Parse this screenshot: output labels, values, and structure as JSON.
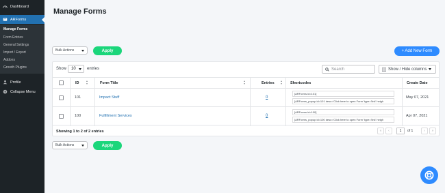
{
  "sidebar": {
    "dashboard": "Dashboard",
    "arforms": "ARForms",
    "submenu": [
      "Manage Forms",
      "Form Entries",
      "General Settings",
      "Import / Export",
      "Addons",
      "Growth Plugins"
    ],
    "profile": "Profile",
    "collapse": "Collapse Menu"
  },
  "page": {
    "title": "Manage Forms"
  },
  "top_actions": {
    "bulk_label": "Bulk Actions",
    "apply_label": "Apply",
    "add_new_label": "+ Add New Form"
  },
  "bottom_actions": {
    "bulk_label": "Bulk Actions",
    "apply_label": "Apply"
  },
  "table_controls": {
    "show_label": "Show",
    "show_value": "10",
    "entries_label": "entries",
    "search_placeholder": "Search",
    "show_hide_label": "Show / Hide columns"
  },
  "columns": {
    "id": "ID",
    "title": "Form Title",
    "entries": "Entries",
    "shortcodes": "Shortcodes",
    "date": "Create Date"
  },
  "rows": [
    {
      "id": "101",
      "title": "Impact Stuff",
      "entries": "0",
      "shortcode1": "[ARForms id=101]",
      "shortcode2": "[ARForms_popup id=101 desc='Click here to open Form' type='link' heigh",
      "date": "May 07, 2021"
    },
    {
      "id": "100",
      "title": "Fulfillment Services",
      "entries": "0",
      "shortcode1": "[ARForms id=100]",
      "shortcode2": "[ARForms_popup id=100 desc='Click here to open Form' type='link' heigh",
      "date": "Apr 07, 2021"
    }
  ],
  "pagination": {
    "info": "Showing 1 to 2 of 2 entries",
    "page": "1",
    "of_label": "of 1"
  },
  "colors": {
    "sidebar_bg": "#1d2327",
    "active_bg": "#2271b1",
    "apply_green": "#1bd67b",
    "add_blue": "#2e8bff",
    "link": "#2271b1"
  }
}
